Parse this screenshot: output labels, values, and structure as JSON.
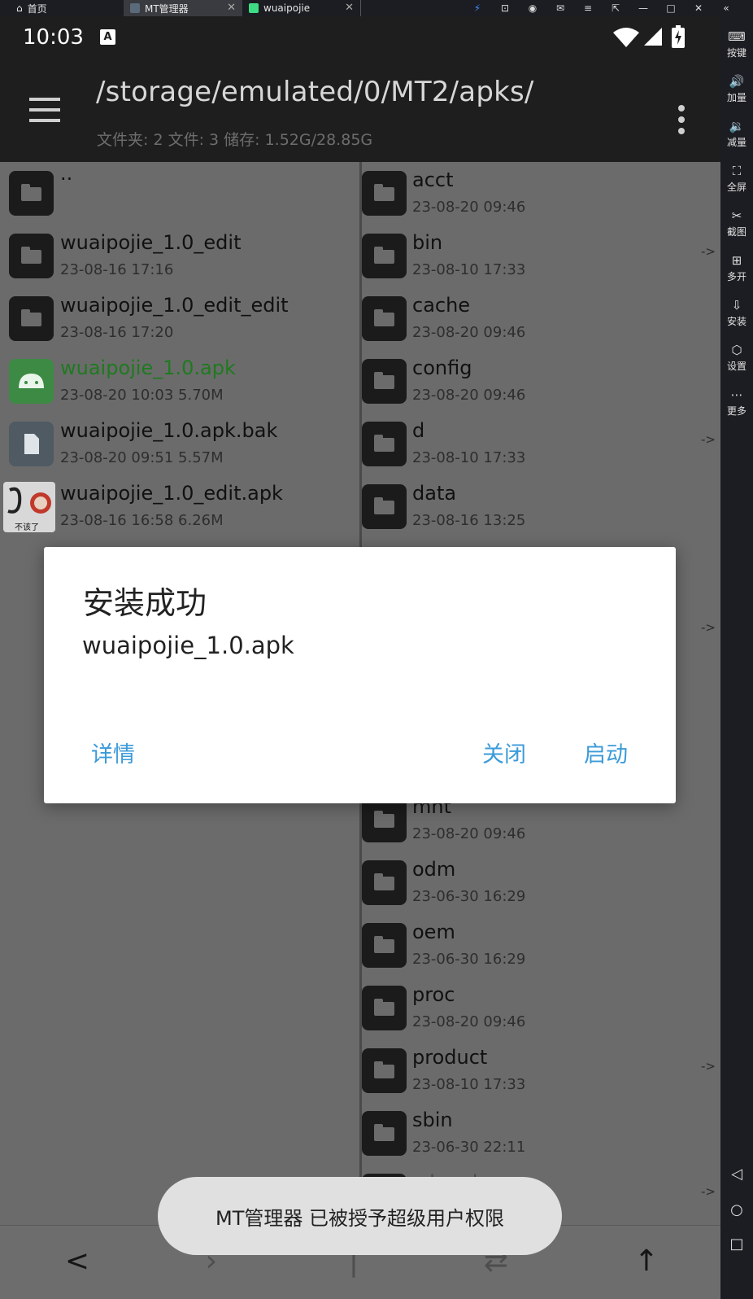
{
  "host_tabs": {
    "home": "首页",
    "mt": "MT管理器",
    "wuaipojie": "wuaipojie"
  },
  "status_bar": {
    "time": "10:03",
    "notif_icon_letter": "A"
  },
  "app_bar": {
    "path": "/storage/emulated/0/MT2/apks/",
    "stats": "文件夹: 2  文件: 3  储存: 1.52G/28.85G"
  },
  "left_files": [
    {
      "name": "..",
      "meta": "",
      "icon": "folder-icon"
    },
    {
      "name": "wuaipojie_1.0_edit",
      "meta": "23-08-16 17:16",
      "icon": "folder-icon"
    },
    {
      "name": "wuaipojie_1.0_edit_edit",
      "meta": "23-08-16 17:20",
      "icon": "folder-icon"
    },
    {
      "name": "wuaipojie_1.0.apk",
      "meta": "23-08-20 10:03  5.70M",
      "icon": "android-apk-icon",
      "color": "#1f7a1f"
    },
    {
      "name": "wuaipojie_1.0.apk.bak",
      "meta": "23-08-20 09:51  5.57M",
      "icon": "file-icon"
    },
    {
      "name": "wuaipojie_1.0_edit.apk",
      "meta": "23-08-16 16:58  6.26M",
      "icon": "app-thumbnail-icon",
      "thumb_text": "不该了"
    }
  ],
  "right_files": [
    {
      "name": "acct",
      "meta": "23-08-20 09:46",
      "link": ""
    },
    {
      "name": "bin",
      "meta": "23-08-10 17:33",
      "link": "->"
    },
    {
      "name": "cache",
      "meta": "23-08-20 09:46",
      "link": ""
    },
    {
      "name": "config",
      "meta": "23-08-20 09:46",
      "link": ""
    },
    {
      "name": "d",
      "meta": "23-08-10 17:33",
      "link": "->"
    },
    {
      "name": "data",
      "meta": "23-08-16 13:25",
      "link": ""
    },
    {
      "name": "",
      "meta": "",
      "link": ""
    },
    {
      "name": "",
      "meta": "",
      "link": "->"
    },
    {
      "name": "",
      "meta": "",
      "link": ""
    },
    {
      "name": "",
      "meta": "",
      "link": ""
    },
    {
      "name": "mnt",
      "meta": "23-08-20 09:46",
      "link": ""
    },
    {
      "name": "odm",
      "meta": "23-06-30 16:29",
      "link": ""
    },
    {
      "name": "oem",
      "meta": "23-06-30 16:29",
      "link": ""
    },
    {
      "name": "proc",
      "meta": "23-08-20 09:46",
      "link": ""
    },
    {
      "name": "product",
      "meta": "23-08-10 17:33",
      "link": "->"
    },
    {
      "name": "sbin",
      "meta": "23-06-30 22:11",
      "link": ""
    },
    {
      "name": "sdcard",
      "meta": "",
      "link": "->"
    }
  ],
  "dialog": {
    "title": "安装成功",
    "message": "wuaipojie_1.0.apk",
    "details": "详情",
    "close": "关闭",
    "launch": "启动"
  },
  "toast": "MT管理器 已被授予超级用户权限",
  "nav": {
    "back": "<",
    "up": "↑"
  },
  "sidebar": [
    {
      "label": "按键",
      "icon": "keyboard-icon",
      "glyph": "⌨"
    },
    {
      "label": "加量",
      "icon": "volume-up-icon",
      "glyph": "🔊"
    },
    {
      "label": "减量",
      "icon": "volume-down-icon",
      "glyph": "🔉"
    },
    {
      "label": "全屏",
      "icon": "fullscreen-icon",
      "glyph": "⛶"
    },
    {
      "label": "截图",
      "icon": "scissors-icon",
      "glyph": "✂"
    },
    {
      "label": "多开",
      "icon": "multi-instance-icon",
      "glyph": "⊞"
    },
    {
      "label": "安装",
      "icon": "apk-install-icon",
      "glyph": "⇩"
    },
    {
      "label": "设置",
      "icon": "settings-icon",
      "glyph": "⬡"
    },
    {
      "label": "更多",
      "icon": "more-icon",
      "glyph": "⋯"
    }
  ],
  "sidebar_nav": {
    "back": "◁",
    "home": "○",
    "recents": "□"
  },
  "colors": {
    "accent": "#3b9bd9",
    "apk_green": "#1f7a1f",
    "appbar": "#1e1e1e",
    "dim": "#6b6b6b"
  }
}
